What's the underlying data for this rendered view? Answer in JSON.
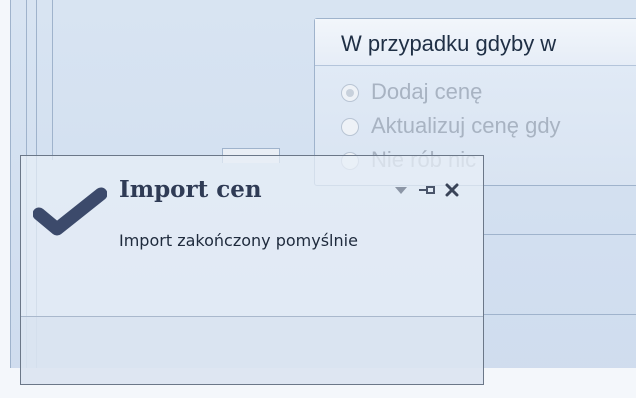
{
  "group": {
    "title": "W przypadku gdyby w",
    "options": [
      {
        "label": "Dodaj cenę",
        "checked": true
      },
      {
        "label": "Aktualizuj cenę gdy",
        "checked": false
      },
      {
        "label": "Nie rób nic",
        "checked": false
      }
    ]
  },
  "toast": {
    "title": "Import cen",
    "message": "Import zakończony pomyślnie",
    "icons": [
      "check-icon",
      "dropdown-arrow-icon",
      "pin-icon",
      "close-icon"
    ]
  },
  "colors": {
    "background": "#d4e0f0",
    "check": "#3c4a6b",
    "toast_border": "#6b7788",
    "disabled_text": "#a8b3c2"
  }
}
